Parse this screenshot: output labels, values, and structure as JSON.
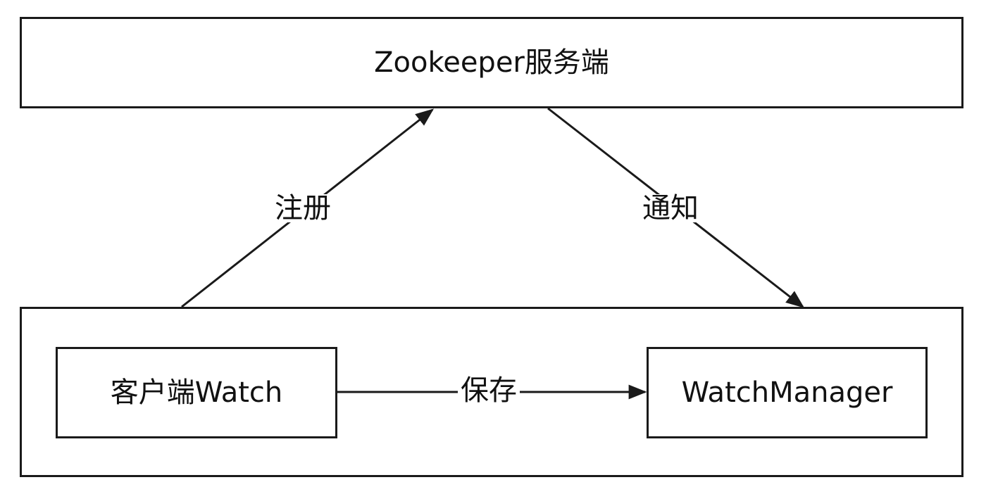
{
  "nodes": {
    "server": {
      "label": "Zookeeper服务端"
    },
    "client_watch": {
      "label": "客户端Watch"
    },
    "watch_manager": {
      "label": "WatchManager"
    }
  },
  "edges": {
    "register": {
      "label": "注册"
    },
    "notify": {
      "label": "通知"
    },
    "save": {
      "label": "保存"
    }
  },
  "colors": {
    "line": "#1a1a1a",
    "background": "#ffffff"
  }
}
